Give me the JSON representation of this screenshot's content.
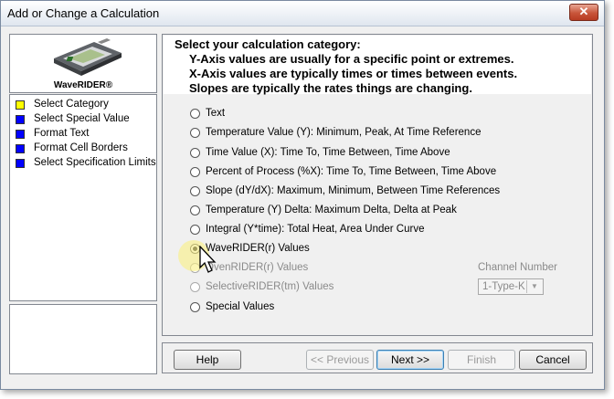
{
  "window": {
    "title": "Add or Change a Calculation",
    "close_label": "✕"
  },
  "logo": {
    "caption": "WaveRIDER®"
  },
  "nav": {
    "items": [
      {
        "label": "Select Category",
        "color": "#ffff00"
      },
      {
        "label": "Select Special Value",
        "color": "#0000ff"
      },
      {
        "label": "Format Text",
        "color": "#0000ff"
      },
      {
        "label": "Format Cell Borders",
        "color": "#0000ff"
      },
      {
        "label": "Select Specification Limits",
        "color": "#0000ff"
      }
    ]
  },
  "header": {
    "line1": "Select your calculation category:",
    "line2": "Y-Axis values are usually for a specific point or extremes.",
    "line3": "X-Axis values are typically times or times between events.",
    "line4": "Slopes are typically the rates things are changing."
  },
  "options": [
    {
      "label": "Text",
      "checked": false,
      "disabled": false
    },
    {
      "label": "Temperature Value (Y):  Minimum, Peak, At Time Reference",
      "checked": false,
      "disabled": false
    },
    {
      "label": "Time Value (X):  Time To, Time Between, Time Above",
      "checked": false,
      "disabled": false
    },
    {
      "label": "Percent of Process (%X):  Time To, Time Between, Time Above",
      "checked": false,
      "disabled": false
    },
    {
      "label": "Slope (dY/dX):  Maximum, Minimum, Between Time References",
      "checked": false,
      "disabled": false
    },
    {
      "label": "Temperature (Y) Delta:  Maximum Delta, Delta at Peak",
      "checked": false,
      "disabled": false
    },
    {
      "label": "Integral (Y*time): Total Heat, Area Under Curve",
      "checked": false,
      "disabled": false
    },
    {
      "label": "WaveRIDER(r) Values",
      "checked": true,
      "disabled": false
    },
    {
      "label": "OvenRIDER(r) Values",
      "checked": false,
      "disabled": true
    },
    {
      "label": "SelectiveRIDER(tm) Values",
      "checked": false,
      "disabled": true
    },
    {
      "label": "Special  Values",
      "checked": false,
      "disabled": false
    }
  ],
  "channel": {
    "label": "Channel Number",
    "value": "1-Type-K"
  },
  "buttons": {
    "help": "Help",
    "previous": "<< Previous",
    "next": "Next >>",
    "finish": "Finish",
    "cancel": "Cancel"
  }
}
